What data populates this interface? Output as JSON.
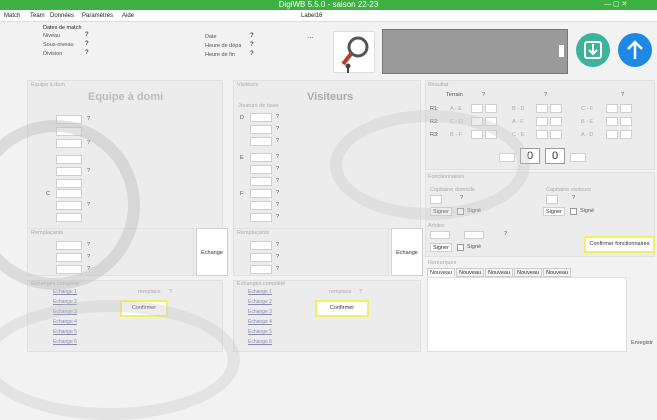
{
  "window": {
    "title": "DigiWB 5.5.0 - saison 22-23",
    "controls": "— ▢ ✕"
  },
  "menu": {
    "items": [
      "Match",
      "Team",
      "Données",
      "Paramètres",
      "Aide"
    ],
    "label": "Label16"
  },
  "info": {
    "dates_title": "Dates de match",
    "niveau": "Niveau",
    "sous_niveau": "Sous-niveau",
    "division": "Division",
    "date": "Date",
    "heure_depart": "Heure de dépa",
    "heure_fin": "Heure de fin",
    "q": "?",
    "ellipsis": "..."
  },
  "home": {
    "section": "Equipe à dom",
    "title": "Equipe à domi",
    "left_label": "C",
    "remplacants": "Remplaçants",
    "echange": "Echange",
    "echanges_title": "Echanges complété",
    "remplace": "remplace",
    "confirmer": "Confirmer",
    "echange_links": [
      "Echange 1",
      "Echange 2",
      "Echange 3",
      "Echange 4",
      "Echange 5",
      "Echange 6"
    ],
    "q": "?"
  },
  "visitors": {
    "section": "Visiteurs",
    "title": "Visiteurs",
    "joueurs": "Joueurs de base",
    "side_labels": [
      "D",
      "E",
      "F"
    ],
    "remplacants": "Remplaçants",
    "echange": "Echange",
    "echanges_title": "Echanges complété",
    "remplace": "remplace",
    "confirmer": "Confirmer",
    "echange_links": [
      "Echange 1",
      "Echange 2",
      "Echange 3",
      "Echange 4",
      "Echange 5",
      "Echange 6"
    ],
    "q": "?"
  },
  "results": {
    "title": "Résultat",
    "terrain": "Terrain",
    "q": "?",
    "rows": [
      {
        "label": "R1:",
        "a": "A - E",
        "b": "B - D",
        "c": "C - F"
      },
      {
        "label": "R2:",
        "a": "C - D",
        "b": "A - F",
        "c": "B - E"
      },
      {
        "label": "R3:",
        "a": "B - F",
        "b": "C - E",
        "c": "A - D"
      }
    ],
    "score_home": "0",
    "score_away": "0"
  },
  "officials": {
    "title": "Fonctionnaires",
    "cap_home": "Capitaine domicile",
    "cap_away": "Capitaine visiteurs",
    "signer": "Signer",
    "signe": "Signé",
    "arbitre": "Arbitre",
    "q": "?",
    "confirm": "Confirmer fonctionnaires"
  },
  "remarks": {
    "title": "Remarques",
    "tabs": [
      "Nouveau",
      "Nouveau",
      "Nouveau",
      "Nouveau",
      "Nouveau"
    ],
    "save": "Enregistr"
  },
  "colors": {
    "titlebar": "#3cb043",
    "teal_button": "#3cb39a",
    "blue_button": "#1e88e5",
    "highlight": "#f0f068"
  }
}
